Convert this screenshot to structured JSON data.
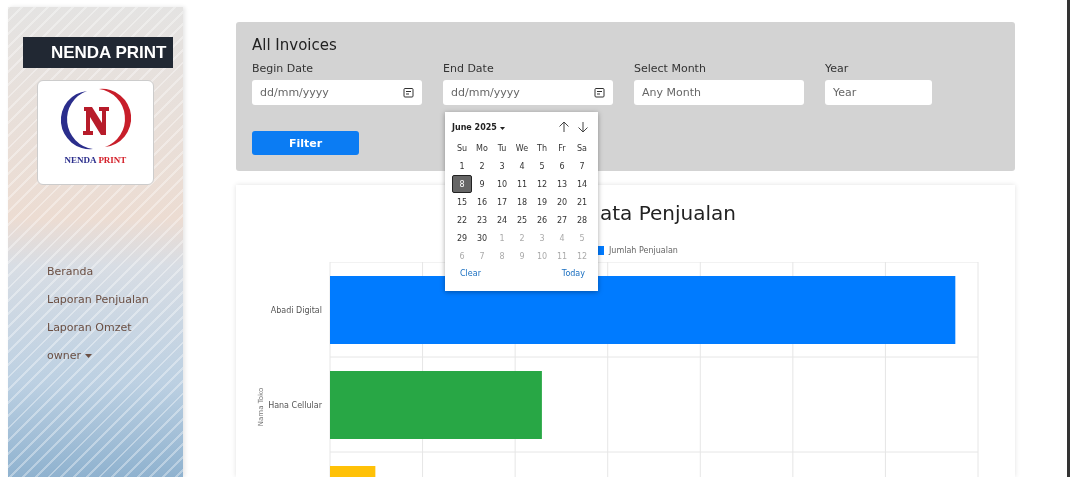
{
  "sidebar": {
    "brand": "NENDA PRINT",
    "logo_words": [
      {
        "text": "NENDA",
        "color": "#2b2e8c"
      },
      {
        "text": "PRINT",
        "color": "#d4202a"
      }
    ],
    "nav": [
      {
        "kind": "link",
        "label": "Beranda"
      },
      {
        "kind": "link",
        "label": "Laporan Penjualan"
      },
      {
        "kind": "link",
        "label": "Laporan Omzet"
      },
      {
        "kind": "dropdown",
        "label": "owner"
      }
    ]
  },
  "filter_card": {
    "title": "All Invoices",
    "fields": [
      {
        "kind": "date",
        "label": "Begin Date",
        "placeholder": "dd/mm/yyyy"
      },
      {
        "kind": "date",
        "label": "End Date",
        "placeholder": "dd/mm/yyyy"
      },
      {
        "kind": "text",
        "label": "Select Month",
        "placeholder": "Any Month"
      },
      {
        "kind": "text",
        "label": "Year",
        "placeholder": "Year"
      }
    ],
    "button": "Filter"
  },
  "date_picker": {
    "month": "June 2025",
    "weekdays": [
      "Su",
      "Mo",
      "Tu",
      "We",
      "Th",
      "Fr",
      "Sa"
    ],
    "days": [
      {
        "label": "1",
        "other_month": false,
        "selected": false
      },
      {
        "label": "2",
        "other_month": false,
        "selected": false
      },
      {
        "label": "3",
        "other_month": false,
        "selected": false
      },
      {
        "label": "4",
        "other_month": false,
        "selected": false
      },
      {
        "label": "5",
        "other_month": false,
        "selected": false
      },
      {
        "label": "6",
        "other_month": false,
        "selected": false
      },
      {
        "label": "7",
        "other_month": false,
        "selected": false
      },
      {
        "label": "8",
        "other_month": false,
        "selected": true
      },
      {
        "label": "9",
        "other_month": false,
        "selected": false
      },
      {
        "label": "10",
        "other_month": false,
        "selected": false
      },
      {
        "label": "11",
        "other_month": false,
        "selected": false
      },
      {
        "label": "12",
        "other_month": false,
        "selected": false
      },
      {
        "label": "13",
        "other_month": false,
        "selected": false
      },
      {
        "label": "14",
        "other_month": false,
        "selected": false
      },
      {
        "label": "15",
        "other_month": false,
        "selected": false
      },
      {
        "label": "16",
        "other_month": false,
        "selected": false
      },
      {
        "label": "17",
        "other_month": false,
        "selected": false
      },
      {
        "label": "18",
        "other_month": false,
        "selected": false
      },
      {
        "label": "19",
        "other_month": false,
        "selected": false
      },
      {
        "label": "20",
        "other_month": false,
        "selected": false
      },
      {
        "label": "21",
        "other_month": false,
        "selected": false
      },
      {
        "label": "22",
        "other_month": false,
        "selected": false
      },
      {
        "label": "23",
        "other_month": false,
        "selected": false
      },
      {
        "label": "24",
        "other_month": false,
        "selected": false
      },
      {
        "label": "25",
        "other_month": false,
        "selected": false
      },
      {
        "label": "26",
        "other_month": false,
        "selected": false
      },
      {
        "label": "27",
        "other_month": false,
        "selected": false
      },
      {
        "label": "28",
        "other_month": false,
        "selected": false
      },
      {
        "label": "29",
        "other_month": false,
        "selected": false
      },
      {
        "label": "30",
        "other_month": false,
        "selected": false
      },
      {
        "label": "1",
        "other_month": true,
        "selected": false
      },
      {
        "label": "2",
        "other_month": true,
        "selected": false
      },
      {
        "label": "3",
        "other_month": true,
        "selected": false
      },
      {
        "label": "4",
        "other_month": true,
        "selected": false
      },
      {
        "label": "5",
        "other_month": true,
        "selected": false
      },
      {
        "label": "6",
        "other_month": true,
        "selected": false
      },
      {
        "label": "7",
        "other_month": true,
        "selected": false
      },
      {
        "label": "8",
        "other_month": true,
        "selected": false
      },
      {
        "label": "9",
        "other_month": true,
        "selected": false
      },
      {
        "label": "10",
        "other_month": true,
        "selected": false
      },
      {
        "label": "11",
        "other_month": true,
        "selected": false
      },
      {
        "label": "12",
        "other_month": true,
        "selected": false
      }
    ],
    "clear": "Clear",
    "today": "Today"
  },
  "chart": {
    "title": "ata Penjualan",
    "legend": "Jumlah Penjualan",
    "ylabel": "Nama Toko",
    "bars": [
      {
        "label": "Abadi Digital",
        "color": "#007bff"
      },
      {
        "label": "Hana Cellular",
        "color": "#28a745"
      },
      {
        "color": "#ffc107"
      }
    ]
  }
}
